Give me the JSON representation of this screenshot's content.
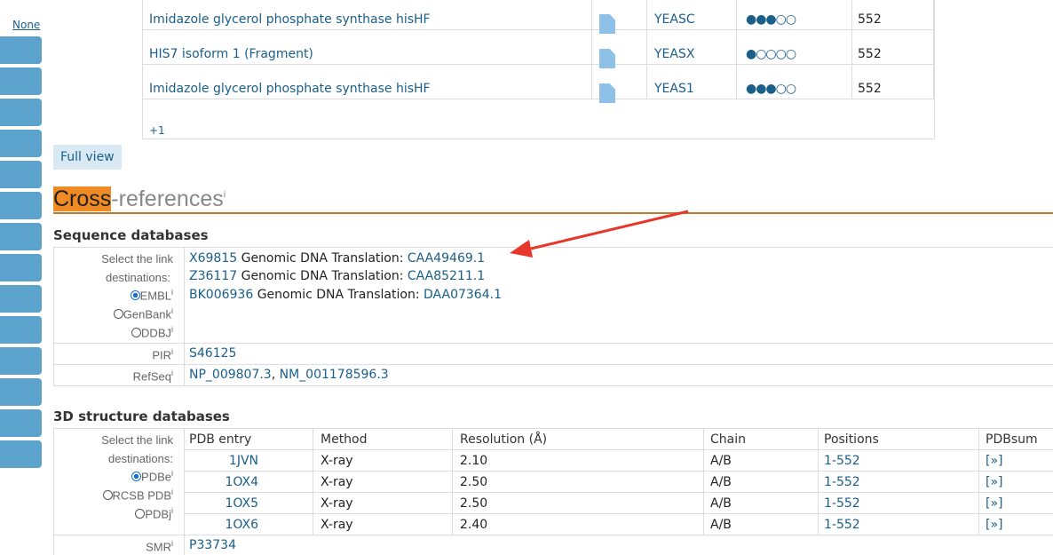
{
  "sidebar": {
    "none_label": "None",
    "button_count": 14
  },
  "entries": {
    "rows": [
      {
        "name": "Imidazole glycerol phosphate synthase hisHF",
        "organism": "YEASC",
        "score": "●●●○○",
        "length": "552"
      },
      {
        "name": "HIS7 isoform 1 (Fragment)",
        "organism": "YEASX",
        "score": "●○○○○",
        "length": "552"
      },
      {
        "name": "Imidazole glycerol phosphate synthase hisHF",
        "organism": "YEAS1",
        "score": "●●●○○",
        "length": "552"
      }
    ],
    "more": "+1"
  },
  "full_view_label": "Full view",
  "section": {
    "title_highlight": "Cross",
    "title_rest": "-references",
    "info": "i"
  },
  "sequence": {
    "heading": "Sequence databases",
    "select_label_1": "Select the link",
    "select_label_2": "destinations:",
    "options": [
      "EMBL",
      "GenBank",
      "DDBJ"
    ],
    "embl_rows": [
      {
        "acc": "X69815",
        "text": "Genomic DNA Translation:",
        "protein": "CAA49469.1"
      },
      {
        "acc": "Z36117",
        "text": "Genomic DNA Translation:",
        "protein": "CAA85211.1"
      },
      {
        "acc": "BK006936",
        "text": "Genomic DNA Translation:",
        "protein": "DAA07364.1"
      }
    ],
    "pir_label": "PIR",
    "pir_value": "S46125",
    "refseq_label": "RefSeq",
    "refseq_1": "NP_009807.3",
    "refseq_sep": ",",
    "refseq_2": "NM_001178596.3"
  },
  "structure": {
    "heading": "3D structure databases",
    "select_label_1": "Select the link",
    "select_label_2": "destinations:",
    "options": [
      "PDBe",
      "RCSB PDB",
      "PDBj"
    ],
    "columns": [
      "PDB entry",
      "Method",
      "Resolution (Å)",
      "Chain",
      "Positions",
      "PDBsum"
    ],
    "rows": [
      {
        "entry": "1JVN",
        "method": "X-ray",
        "resolution": "2.10",
        "chain": "A/B",
        "positions": "1-552",
        "pdbsum": "[»]"
      },
      {
        "entry": "1OX4",
        "method": "X-ray",
        "resolution": "2.50",
        "chain": "A/B",
        "positions": "1-552",
        "pdbsum": "[»]"
      },
      {
        "entry": "1OX5",
        "method": "X-ray",
        "resolution": "2.50",
        "chain": "A/B",
        "positions": "1-552",
        "pdbsum": "[»]"
      },
      {
        "entry": "1OX6",
        "method": "X-ray",
        "resolution": "2.40",
        "chain": "A/B",
        "positions": "1-552",
        "pdbsum": "[»]"
      }
    ],
    "smr_label": "SMR",
    "smr_value": "P33734"
  },
  "colors": {
    "link": "#1a5e8a",
    "accent": "#f08a24",
    "arrow": "#e8362a",
    "sidebar": "#5ba3cd"
  }
}
